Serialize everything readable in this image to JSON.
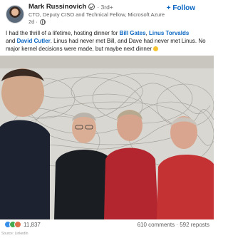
{
  "post": {
    "author": "Mark Russinovich",
    "degree": "· 3rd+",
    "headline": "CTO, Deputy CISO and Technical Fellow, Microsoft Azure",
    "time": "2d ·",
    "follow_label": "+ Follow",
    "text": {
      "line1_prefix": "I had the thrill of a lifetime, hosting dinner for ",
      "mention1": "Bill Gates",
      "comma": ", ",
      "mention2": "Linus Torvalds",
      "and": "and ",
      "mention3": "David Cutler",
      "rest": ". Linus had never met Bill, and Dave had never met Linus. No major kernel decisions were made, but maybe next dinner "
    }
  },
  "footer": {
    "reaction_count": "11,837",
    "comments": "610 comments",
    "separator": " · ",
    "reposts": "592 reposts",
    "source": "Source: LinkedIn"
  },
  "icons": {
    "verified": "verified-icon",
    "globe": "globe-icon",
    "like": "like-icon",
    "clap": "clap-icon",
    "love": "love-icon"
  },
  "colors": {
    "link": "#0a66c2",
    "like": "#378fe9",
    "clap": "#44aa52",
    "love": "#df704d"
  }
}
